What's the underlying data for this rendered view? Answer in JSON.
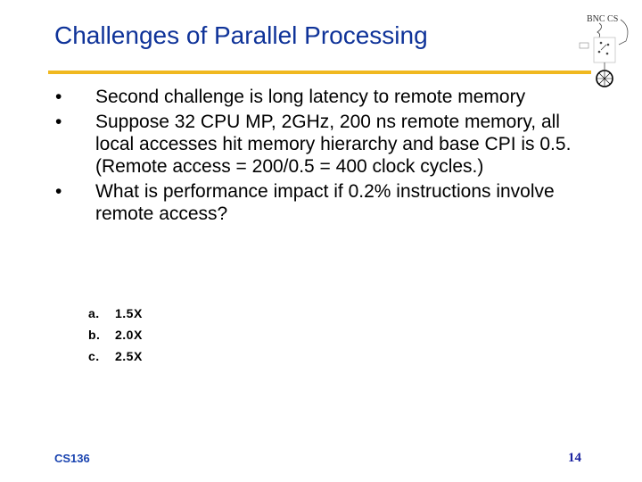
{
  "slide": {
    "title": "Challenges of Parallel Processing",
    "accent_color": "#f0b820",
    "title_color": "#0f3399",
    "logo": {
      "icon": "bnc-cs-logo-icon",
      "label": "BNC CS"
    },
    "bullets": [
      {
        "marker": "•",
        "text": "Second challenge is long latency to remote memory"
      },
      {
        "marker": "•",
        "text": "Suppose 32 CPU MP, 2GHz, 200 ns remote memory, all local accesses hit memory hierarchy and base CPI is 0.5. (Remote access = 200/0.5 = 400 clock cycles.)"
      },
      {
        "marker": "•",
        "text": "What is performance impact if 0.2% instructions involve remote access?"
      }
    ],
    "options": [
      {
        "letter": "a.",
        "text": "1.5X"
      },
      {
        "letter": "b.",
        "text": "2.0X"
      },
      {
        "letter": "c.",
        "text": "2.5X"
      }
    ],
    "footer": {
      "course": "CS136",
      "page_number": "14"
    }
  }
}
